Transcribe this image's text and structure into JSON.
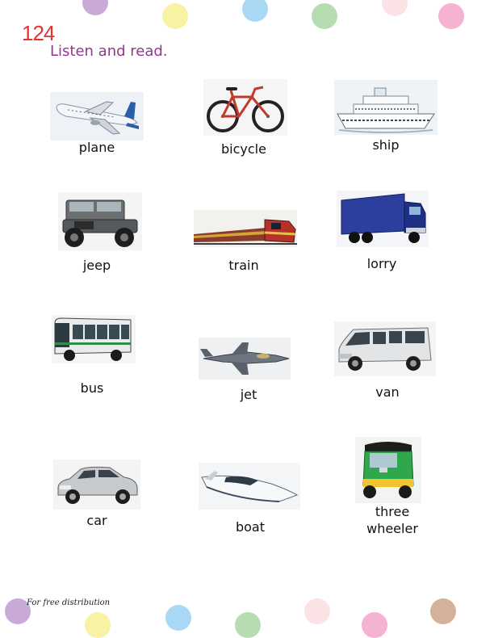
{
  "page": {
    "number": "124",
    "instruction": "Listen and read.",
    "footer": "For free distribution"
  },
  "decor": {
    "dot_colors": [
      "#c9a9d8",
      "#f8f2a4",
      "#a9d8f5",
      "#b7dcb2",
      "#fbe3e5",
      "#f5b2d2",
      "#d4b29a"
    ]
  },
  "vehicles": [
    {
      "label": "plane",
      "icon": "airplane-photo"
    },
    {
      "label": "bicycle",
      "icon": "bicycle-photo"
    },
    {
      "label": "ship",
      "icon": "cruise-ship-photo"
    },
    {
      "label": "jeep",
      "icon": "jeep-photo"
    },
    {
      "label": "train",
      "icon": "train-photo"
    },
    {
      "label": "lorry",
      "icon": "lorry-photo"
    },
    {
      "label": "bus",
      "icon": "bus-photo"
    },
    {
      "label": "jet",
      "icon": "fighter-jet-photo"
    },
    {
      "label": "van",
      "icon": "van-photo"
    },
    {
      "label": "car",
      "icon": "car-photo"
    },
    {
      "label": "boat",
      "icon": "speedboat-photo"
    },
    {
      "label": "three wheeler",
      "icon": "three-wheeler-photo"
    }
  ]
}
